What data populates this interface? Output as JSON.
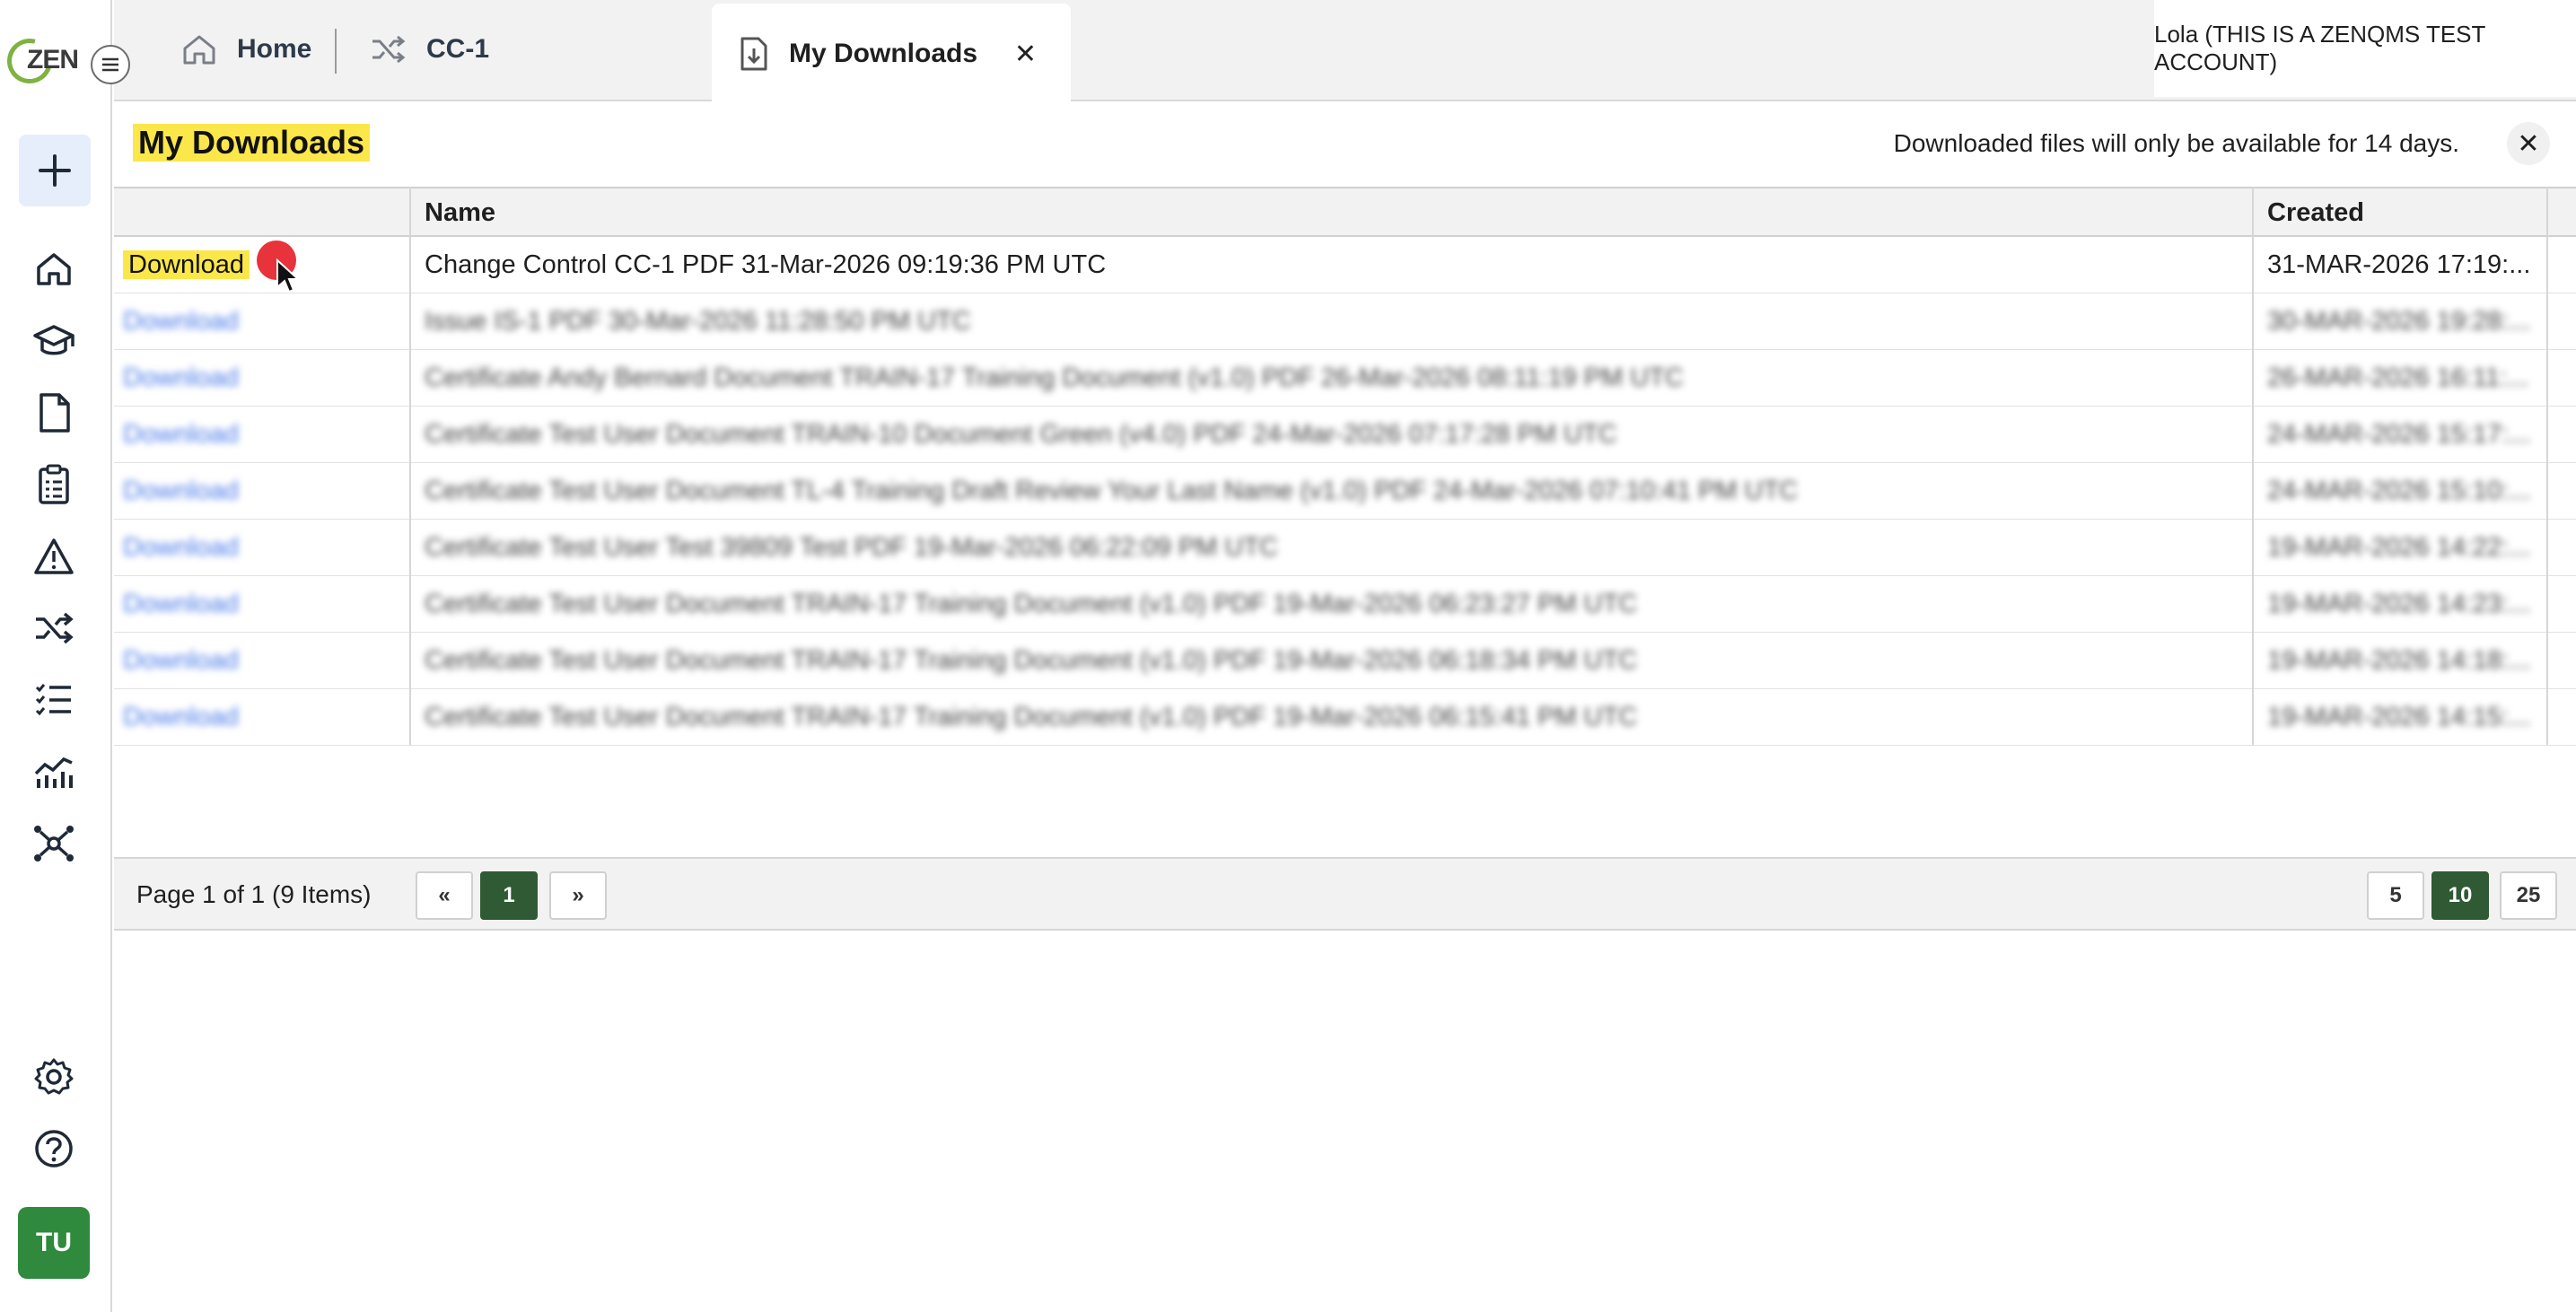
{
  "app": {
    "logo_text": "ZEN",
    "user_initials": "TU"
  },
  "tabs": [
    {
      "label": "Home",
      "icon": "home-icon"
    },
    {
      "label": "CC-1",
      "icon": "shuffle-icon"
    },
    {
      "label": "My Downloads",
      "icon": "file-download-icon",
      "close": "✕"
    }
  ],
  "account": "Lola (THIS IS A ZENQMS TEST ACCOUNT)",
  "page": {
    "title": "My Downloads",
    "notice": "Downloaded files will only be available for 14 days.",
    "close": "✕"
  },
  "table": {
    "columns": [
      "",
      "Name",
      "Created"
    ],
    "rows": [
      {
        "action": "Download",
        "name": "Change Control CC-1 PDF 31-Mar-2026 09:19:36 PM UTC",
        "created": "31-MAR-2026 17:19:..."
      },
      {
        "action": "Download",
        "name": "Issue IS-1 PDF 30-Mar-2026 11:28:50 PM UTC",
        "created": "30-MAR-2026 19:28:..."
      },
      {
        "action": "Download",
        "name": "Certificate Andy Bernard Document TRAIN-17 Training Document (v1.0) PDF 26-Mar-2026 08:11:19 PM UTC",
        "created": "26-MAR-2026 16:11:..."
      },
      {
        "action": "Download",
        "name": "Certificate Test User Document TRAIN-10 Document Green (v4.0) PDF 24-Mar-2026 07:17:28 PM UTC",
        "created": "24-MAR-2026 15:17:..."
      },
      {
        "action": "Download",
        "name": "Certificate Test User Document TL-4 Training Draft Review Your Last Name (v1.0) PDF 24-Mar-2026 07:10:41 PM UTC",
        "created": "24-MAR-2026 15:10:..."
      },
      {
        "action": "Download",
        "name": "Certificate Test User Test 39809 Test PDF 19-Mar-2026 06:22:09 PM UTC",
        "created": "19-MAR-2026 14:22:..."
      },
      {
        "action": "Download",
        "name": "Certificate Test User Document TRAIN-17 Training Document (v1.0) PDF 19-Mar-2026 06:23:27 PM UTC",
        "created": "19-MAR-2026 14:23:..."
      },
      {
        "action": "Download",
        "name": "Certificate Test User Document TRAIN-17 Training Document (v1.0) PDF 19-Mar-2026 06:18:34 PM UTC",
        "created": "19-MAR-2026 14:18:..."
      },
      {
        "action": "Download",
        "name": "Certificate Test User Document TRAIN-17 Training Document (v1.0) PDF 19-Mar-2026 06:15:41 PM UTC",
        "created": "19-MAR-2026 14:15:..."
      }
    ]
  },
  "pager": {
    "info": "Page 1 of 1 (9 Items)",
    "prev": "«",
    "current": "1",
    "next": "»",
    "sizes": [
      "5",
      "10",
      "25"
    ],
    "active_size": "10"
  },
  "colors": {
    "highlight": "#fbe74a",
    "accent_green": "#2f5a33",
    "link": "#3b6ee0"
  }
}
